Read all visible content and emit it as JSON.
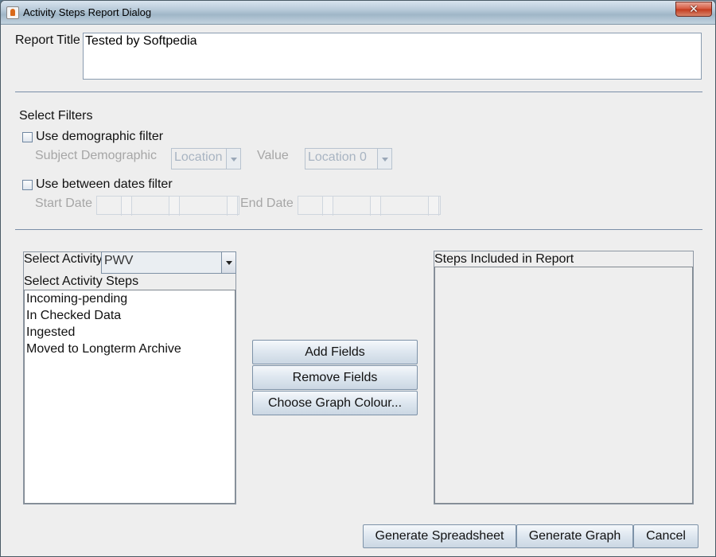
{
  "window": {
    "title": "Activity Steps Report Dialog",
    "close_label": "✕"
  },
  "report_title": {
    "label": "Report Title",
    "value": "Tested by Softpedia"
  },
  "filters": {
    "section_label": "Select Filters",
    "demographic": {
      "checkbox_label": "Use demographic filter",
      "subject_label": "Subject Demographic",
      "subject_value": "Location",
      "value_label": "Value",
      "value_value": "Location 0"
    },
    "dates": {
      "checkbox_label": "Use between dates filter",
      "start_label": "Start Date",
      "end_label": "End Date"
    }
  },
  "activity": {
    "select_label": "Select Activity",
    "selected": "PWV",
    "steps_label": "Select Activity Steps",
    "steps": [
      "Incoming-pending",
      "In Checked Data",
      "Ingested",
      "Moved to Longterm Archive"
    ]
  },
  "actions": {
    "add_fields": "Add Fields",
    "remove_fields": "Remove Fields",
    "choose_colour": "Choose Graph Colour..."
  },
  "included": {
    "label": "Steps Included in Report"
  },
  "footer": {
    "spreadsheet": "Generate Spreadsheet",
    "graph": "Generate Graph",
    "cancel": "Cancel"
  }
}
